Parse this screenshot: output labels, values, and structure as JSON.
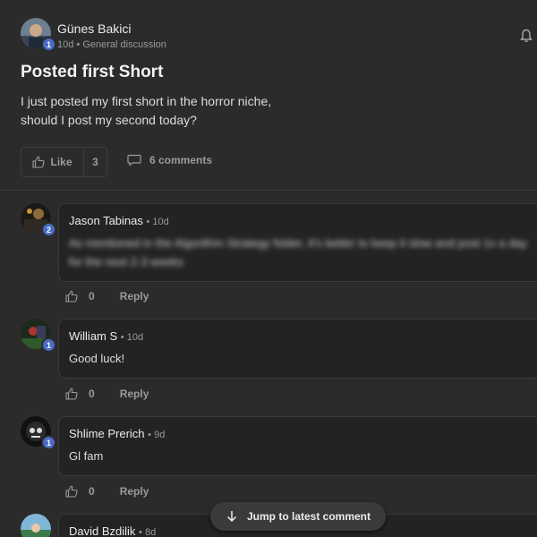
{
  "post": {
    "author": "Günes Bakici",
    "author_level": "1",
    "time": "10d",
    "category": "General discussion",
    "title": "Posted first Short",
    "body_line1": "I just posted my first short in the horror niche,",
    "body_line2": "should I post my second today?",
    "like_label": "Like",
    "like_count": "3",
    "comments_label": "6 comments"
  },
  "comments": [
    {
      "author": "Jason Tabinas",
      "time": "10d",
      "level": "2",
      "text_line1": "As mentioned in the Algorithm Strategy folder, it's better to keep it slow and post 1x a day",
      "text_line2": "for the next 2-3 weeks",
      "likes": "0",
      "reply": "Reply"
    },
    {
      "author": "William S",
      "time": "10d",
      "level": "1",
      "text_line1": "Good luck!",
      "likes": "0",
      "reply": "Reply"
    },
    {
      "author": "Shlime Prerich",
      "time": "9d",
      "level": "1",
      "text_line1": "Gl fam",
      "likes": "0",
      "reply": "Reply"
    },
    {
      "author": "David Bzdilik",
      "time": "8d"
    }
  ],
  "jump_label": "Jump to latest comment",
  "colors": {
    "badge": "#4a6cc7",
    "background": "#2b2b2b",
    "bubble": "#232323"
  }
}
